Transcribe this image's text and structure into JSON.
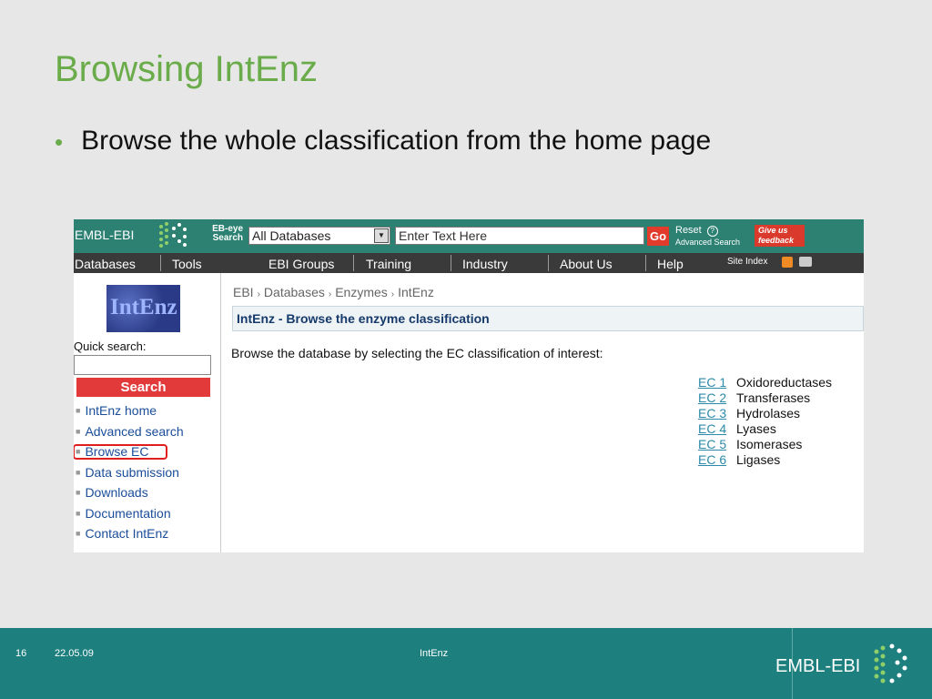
{
  "slide": {
    "title": "Browsing IntEnz",
    "bullet": "Browse the whole classification from the home page"
  },
  "screenshot": {
    "topbar": {
      "logo": "EMBL-EBI",
      "ebeye_line1": "EB-eye",
      "ebeye_line2": "Search",
      "db_select_value": "All Databases",
      "search_placeholder": "Enter Text Here",
      "go_label": "Go",
      "reset_label": "Reset",
      "advanced_search_label": "Advanced Search",
      "feedback_line1": "Give us",
      "feedback_line2": "feedback"
    },
    "nav": {
      "items": [
        "Databases",
        "Tools",
        "EBI Groups",
        "Training",
        "Industry",
        "About Us",
        "Help"
      ],
      "site_index": "Site Index"
    },
    "sidebar": {
      "logo_text": "IntEnz",
      "quick_search_label": "Quick search:",
      "search_button": "Search",
      "links": [
        "IntEnz home",
        "Advanced search",
        "Browse EC",
        "Data submission",
        "Downloads",
        "Documentation",
        "Contact IntEnz"
      ]
    },
    "breadcrumb": [
      "EBI",
      "Databases",
      "Enzymes",
      "IntEnz"
    ],
    "content_title": "IntEnz - Browse the enzyme classification",
    "intro": "Browse the database by selecting the EC classification of interest:",
    "ec_classes": [
      {
        "code": "EC 1",
        "name": "Oxidoreductases"
      },
      {
        "code": "EC 2",
        "name": "Transferases"
      },
      {
        "code": "EC 3",
        "name": "Hydrolases"
      },
      {
        "code": "EC 4",
        "name": "Lyases"
      },
      {
        "code": "EC 5",
        "name": "Isomerases"
      },
      {
        "code": "EC 6",
        "name": "Ligases"
      }
    ]
  },
  "footer": {
    "slide_number": "16",
    "date": "22.05.09",
    "center_text": "IntEnz",
    "logo": "EMBL-EBI"
  },
  "colors": {
    "title_green": "#6aab4a",
    "topbar_teal": "#2c8173",
    "footer_teal": "#1d7f7e",
    "highlight_red": "#e01e1e"
  }
}
